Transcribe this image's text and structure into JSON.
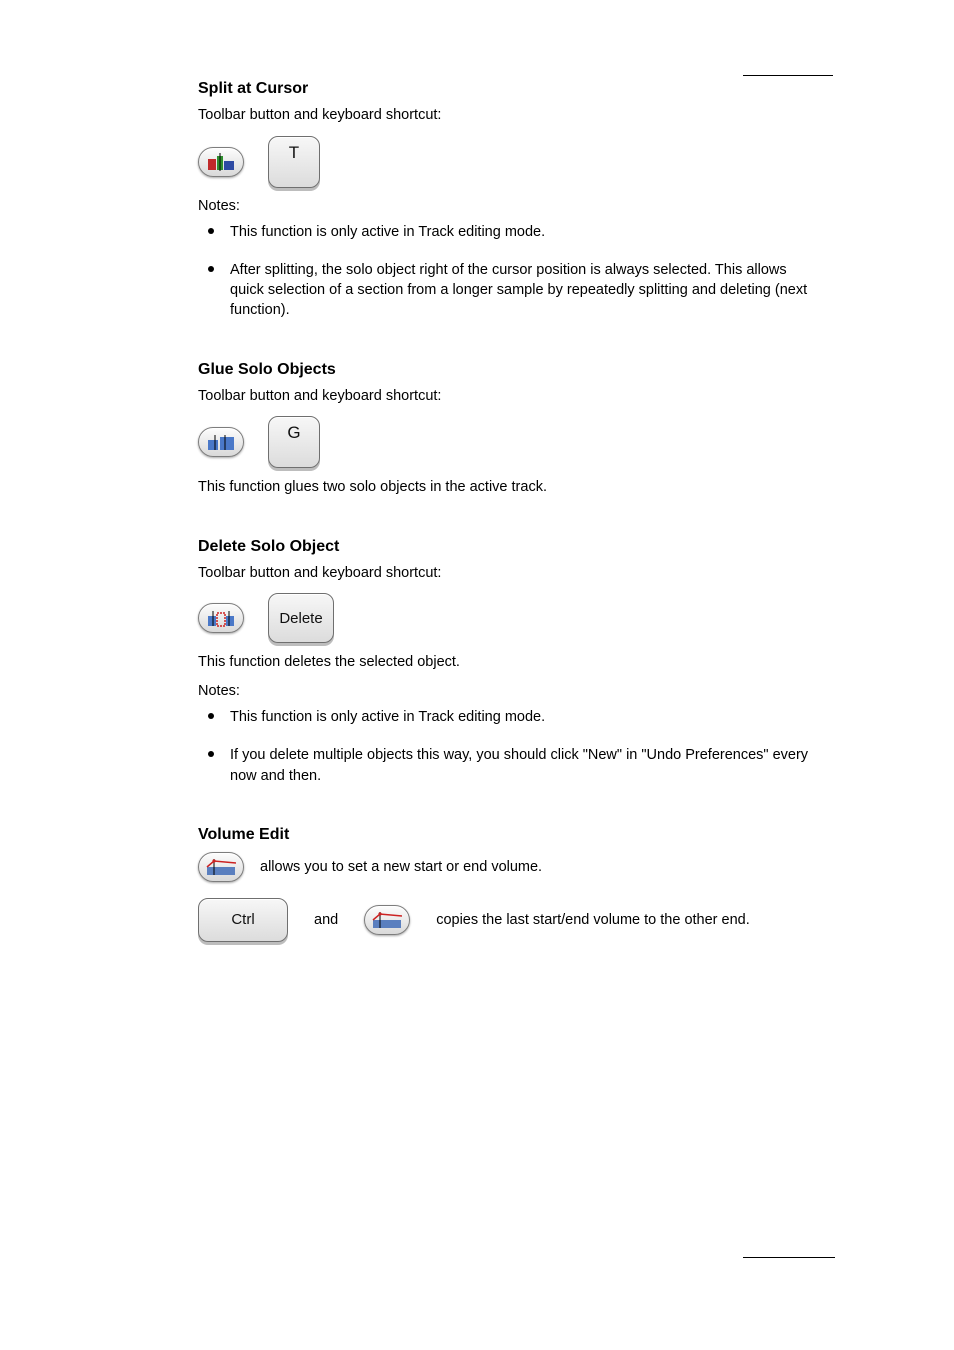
{
  "section1": {
    "title": "Split at Cursor",
    "desc": "Toolbar button and keyboard shortcut:",
    "key": "T",
    "notes_intro": "Notes:",
    "notes": [
      "This function is only active in Track editing mode.",
      "After splitting, the solo object right of the cursor position is always selected. This allows quick selection of a section from a longer sample by repeatedly splitting and deleting (next function)."
    ]
  },
  "section2": {
    "title": "Glue Solo Objects",
    "desc": "Toolbar button and keyboard shortcut:",
    "key": "G",
    "body": "This function glues two solo objects in the active track."
  },
  "section3": {
    "title": "Delete Solo Object",
    "desc": "Toolbar button and keyboard shortcut:",
    "key": "Delete",
    "body": "This function deletes the selected object.",
    "notes_intro": "Notes:",
    "notes": [
      "This function is only active in Track editing mode.",
      "If you delete multiple objects this way, you should click \"New\" in \"Undo Preferences\" every now and then."
    ]
  },
  "section4": {
    "title": "Volume Edit",
    "desc1_before": "",
    "desc1_after": " allows you to set a new start or end volume.",
    "desc2_before": "",
    "desc2_mid": " and ",
    "desc2_after": " copies the last start/end volume to the other end.",
    "ctrl_key": "Ctrl"
  }
}
